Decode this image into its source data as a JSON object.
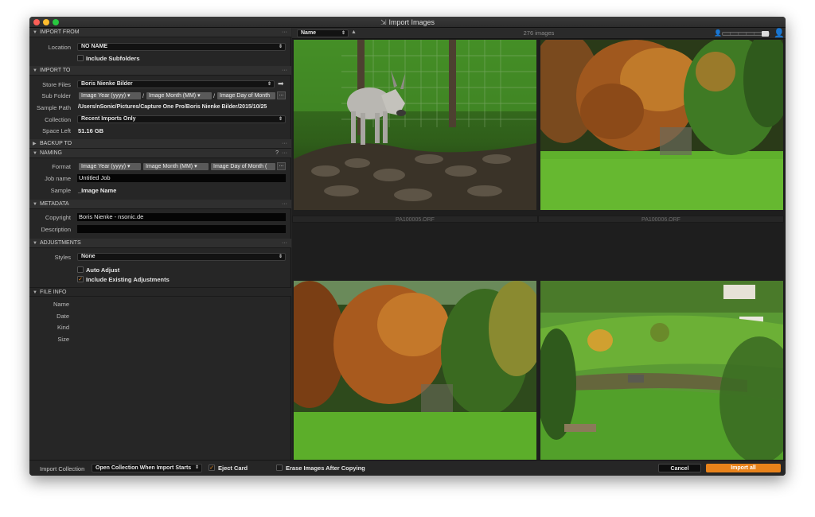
{
  "window": {
    "title": "Import Images"
  },
  "sections": {
    "import_from": {
      "title": "IMPORT FROM",
      "location_label": "Location",
      "location_value": "NO NAME",
      "include_subfolders": "Include Subfolders"
    },
    "import_to": {
      "title": "IMPORT TO",
      "store_files_label": "Store Files",
      "store_files_value": "Boris Nienke Bilder",
      "sub_folder_label": "Sub Folder",
      "sub_folder_tokens": [
        "Image Year (yyyy)",
        "Image Month (MM)",
        "Image Day of Month"
      ],
      "sample_path_label": "Sample Path",
      "sample_path_value": "/Users/nSonic/Pictures/Capture One Pro/Boris Nienke Bilder/2015/10/25",
      "collection_label": "Collection",
      "collection_value": "Recent Imports Only",
      "space_left_label": "Space Left",
      "space_left_value": "51.16 GB"
    },
    "backup_to": {
      "title": "BACKUP TO"
    },
    "naming": {
      "title": "NAMING",
      "help": "?",
      "format_label": "Format",
      "format_tokens": [
        "Image Year (yyyy)",
        "Image Month (MM)",
        "Image Day of Month ("
      ],
      "job_name_label": "Job name",
      "job_name_value": "Untitled Job",
      "sample_label": "Sample",
      "sample_value": "_Image Name"
    },
    "metadata": {
      "title": "METADATA",
      "copyright_label": "Copyright",
      "copyright_value": "Boris Nienke - nsonic.de",
      "description_label": "Description",
      "description_value": ""
    },
    "adjustments": {
      "title": "ADJUSTMENTS",
      "styles_label": "Styles",
      "styles_value": "None",
      "auto_adjust": "Auto Adjust",
      "auto_adjust_checked": false,
      "include_existing": "Include Existing Adjustments",
      "include_existing_checked": true
    },
    "file_info": {
      "title": "FILE INFO",
      "fields": [
        "Name",
        "Date",
        "Kind",
        "Size"
      ]
    },
    "menu_glyph": "···",
    "dots_glyph": "..."
  },
  "browser": {
    "sort_value": "Name",
    "count": "276 images",
    "thumbnails": [
      {
        "caption": "PA100005.ORF",
        "scene": "donkey"
      },
      {
        "caption": "PA100006.ORF",
        "scene": "trees"
      },
      {
        "caption": "",
        "scene": "trees2"
      },
      {
        "caption": "",
        "scene": "valley"
      }
    ]
  },
  "footer": {
    "import_collection_label": "Import Collection",
    "import_collection_value": "Open Collection When Import Starts",
    "eject_card": "Eject Card",
    "eject_card_checked": true,
    "erase_images": "Erase Images After Copying",
    "erase_images_checked": false,
    "cancel": "Cancel",
    "import_all": "Import all"
  },
  "colors": {
    "accent": "#e8821a",
    "panel": "#262626",
    "check": "#f08a1c"
  }
}
